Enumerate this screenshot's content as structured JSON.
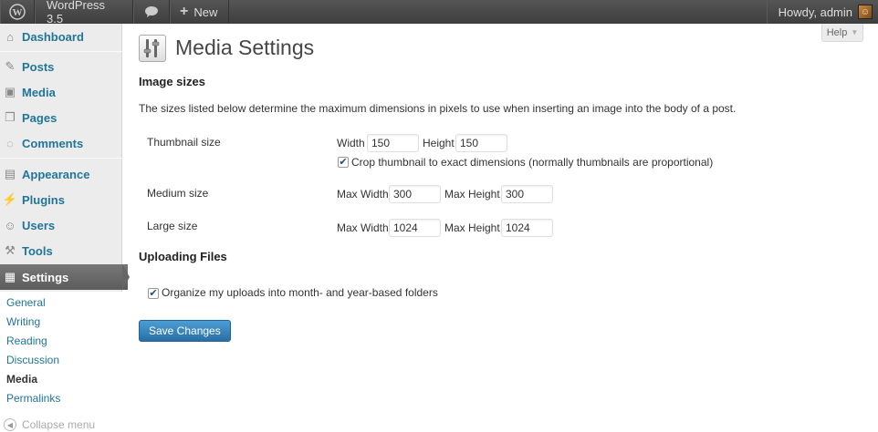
{
  "adminbar": {
    "site_name": "WordPress 3.5",
    "new_label": "New",
    "howdy": "Howdy, admin"
  },
  "sidebar": {
    "items": [
      {
        "label": "Dashboard",
        "icon": "dashboard-icon"
      },
      {
        "label": "Posts",
        "icon": "pin-icon"
      },
      {
        "label": "Media",
        "icon": "media-icon"
      },
      {
        "label": "Pages",
        "icon": "pages-icon"
      },
      {
        "label": "Comments",
        "icon": "comment-icon"
      },
      {
        "label": "Appearance",
        "icon": "appearance-icon"
      },
      {
        "label": "Plugins",
        "icon": "plugin-icon"
      },
      {
        "label": "Users",
        "icon": "users-icon"
      },
      {
        "label": "Tools",
        "icon": "tools-icon"
      },
      {
        "label": "Settings",
        "icon": "settings-icon"
      }
    ],
    "submenu": [
      "General",
      "Writing",
      "Reading",
      "Discussion",
      "Media",
      "Permalinks"
    ],
    "current_submenu": "Media",
    "collapse_label": "Collapse menu"
  },
  "help_label": "Help",
  "page_title": "Media Settings",
  "image_sizes": {
    "heading": "Image sizes",
    "description": "The sizes listed below determine the maximum dimensions in pixels to use when inserting an image into the body of a post.",
    "thumbnail": {
      "label": "Thumbnail size",
      "width_label": "Width",
      "width": "150",
      "height_label": "Height",
      "height": "150",
      "crop_label": "Crop thumbnail to exact dimensions (normally thumbnails are proportional)",
      "crop_checked": true
    },
    "medium": {
      "label": "Medium size",
      "max_width_label": "Max Width",
      "max_width": "300",
      "max_height_label": "Max Height",
      "max_height": "300"
    },
    "large": {
      "label": "Large size",
      "max_width_label": "Max Width",
      "max_width": "1024",
      "max_height_label": "Max Height",
      "max_height": "1024"
    }
  },
  "uploading": {
    "heading": "Uploading Files",
    "organize_label": "Organize my uploads into month- and year-based folders",
    "organize_checked": true
  },
  "save_label": "Save Changes",
  "colors": {
    "link": "#21759b",
    "admin_bar": "#464646",
    "primary_button": "#2a6fa5"
  }
}
